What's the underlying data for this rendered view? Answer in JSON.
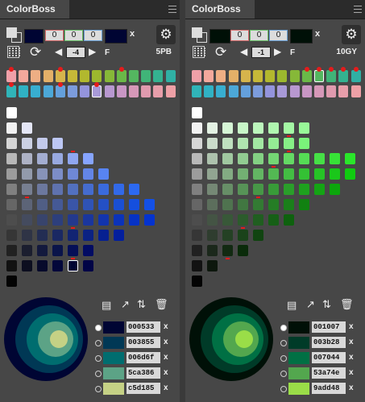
{
  "panels": [
    {
      "id": "left",
      "tab_title": "ColorBoss",
      "current_color": "#000533",
      "rgb": [
        "0",
        "0",
        "0"
      ],
      "rgb_outline": [
        "#d36a6a",
        "#6abf6a",
        "#6a9fd3"
      ],
      "clear_label": "x",
      "step_value": "-4",
      "f_label": "F",
      "hue_code": "5PB",
      "hue_row1": [
        "#f0a0a8",
        "#f4a89c",
        "#eeae84",
        "#e4b068",
        "#d6b44c",
        "#c6b838",
        "#b2b82e",
        "#9cb82e",
        "#86b838",
        "#6ab848",
        "#54b660",
        "#40b478",
        "#34b290",
        "#30b0a4"
      ],
      "hue_row2": [
        "#30b4b8",
        "#30b2c4",
        "#38aed0",
        "#4ca8d8",
        "#64a0dc",
        "#7c9cdc",
        "#9494dc",
        "#a89ad8",
        "#b898d0",
        "#c896c4",
        "#d698b8",
        "#e09aae",
        "#e89eaa",
        "#eea0a6"
      ],
      "hue_selected": 7,
      "hue_markers": [
        0,
        4,
        9
      ],
      "hue_row2_markers": [
        0,
        4,
        7
      ],
      "chart_rows": [
        [
          "#ffffff"
        ],
        [
          "#f2f2f2",
          "#e4e6f6"
        ],
        [
          "#d6d6d6",
          "#cbd0e3",
          "#c3caeb",
          "#bdc7f4"
        ],
        [
          "#b8b8b8",
          "#adb2c5",
          "#a3add1",
          "#98a9e0",
          "#8fa6f0",
          "#86a4ff"
        ],
        [
          "#9c9c9c",
          "#929aab",
          "#8793b8",
          "#7c8dc7",
          "#6f88d6",
          "#6385e6",
          "#5884f2"
        ],
        [
          "#808080",
          "#777f91",
          "#6c789e",
          "#5f72ae",
          "#5270bf",
          "#456ccf",
          "#3a6add",
          "#3269e8",
          "#2c69f2"
        ],
        [
          "#666666",
          "#5c6477",
          "#505e85",
          "#455996",
          "#3a55a7",
          "#2f53b6",
          "#2450c5",
          "#1a4fd3",
          "#154fde",
          "#1350e6"
        ],
        [
          "#4d4d4d",
          "#444b5e",
          "#38446c",
          "#2d3f7c",
          "#23398d",
          "#1a369d",
          "#1234ad",
          "#0b33ba",
          "#0632c5",
          "#0433cf"
        ],
        [
          "#363636",
          "#2f3446",
          "#232d53",
          "#1a2863",
          "#122473",
          "#0b2283",
          "#062091",
          "#031f9d"
        ],
        [
          "#212121",
          "#1b1e2f",
          "#13193d",
          "#0a144a",
          "#050f57",
          "#020c63"
        ],
        [
          "#121212",
          "#0c0e1f",
          "#070a2b",
          "#03073a",
          "#000533",
          "#000446"
        ],
        [
          "#030303"
        ]
      ],
      "chart_selected": [
        10,
        4
      ],
      "chart_markers": [
        [
          3,
          4
        ],
        [
          6,
          1
        ],
        [
          8,
          4
        ],
        [
          10,
          4
        ]
      ],
      "palette": [
        {
          "hex": "000533",
          "color": "#000533"
        },
        {
          "hex": "003855",
          "color": "#003855"
        },
        {
          "hex": "006d6f",
          "color": "#006d6f"
        },
        {
          "hex": "5ca386",
          "color": "#5ca386"
        },
        {
          "hex": "c5d185",
          "color": "#c5d185"
        }
      ],
      "palette_selected": 0,
      "remove_label": "x"
    },
    {
      "id": "right",
      "tab_title": "ColorBoss",
      "current_color": "#001007",
      "rgb": [
        "0",
        "0",
        "0"
      ],
      "rgb_outline": [
        "#d36a6a",
        "#6abf6a",
        "#6a9fd3"
      ],
      "clear_label": "x",
      "step_value": "-1",
      "f_label": "F",
      "hue_code": "10GY",
      "hue_row1": [
        "#f0a0a8",
        "#f4a89c",
        "#eeae84",
        "#e4b068",
        "#d6b44c",
        "#c6b838",
        "#b2b82e",
        "#9cb82e",
        "#86b838",
        "#6ab848",
        "#54b660",
        "#40b478",
        "#34b290",
        "#30b0a4"
      ],
      "hue_row2": [
        "#30b4b8",
        "#30b2c4",
        "#38aed0",
        "#4ca8d8",
        "#64a0dc",
        "#7c9cdc",
        "#9494dc",
        "#a89ad8",
        "#b898d0",
        "#c896c4",
        "#d698b8",
        "#e09aae",
        "#e89eaa",
        "#eea0a6"
      ],
      "hue_selected": 10,
      "hue_markers": [
        9,
        10,
        11,
        12,
        13
      ],
      "hue_row2_markers": [],
      "chart_rows": [
        [
          "#ffffff"
        ],
        [
          "#f2f2f2",
          "#e4f2e4",
          "#d6f6d6",
          "#c8f6c8",
          "#bcf7bc",
          "#b0f7b0",
          "#a4f8a4",
          "#98f898"
        ],
        [
          "#d6d6d6",
          "#cbdccb",
          "#bfe0bf",
          "#b0e4b0",
          "#a2e8a2",
          "#94ec94",
          "#86ef86",
          "#7af27a"
        ],
        [
          "#b8b8b8",
          "#adc2ad",
          "#a0c8a0",
          "#92cc92",
          "#83d183",
          "#74d574",
          "#64d964",
          "#55dd55",
          "#46e046",
          "#37e337",
          "#2ae62a"
        ],
        [
          "#9c9c9c",
          "#91a591",
          "#83ab83",
          "#73b073",
          "#63b563",
          "#53b953",
          "#43bd43",
          "#34c134",
          "#26c426",
          "#1ac71a",
          "#10ca10"
        ],
        [
          "#808080",
          "#758875",
          "#678e67",
          "#579357",
          "#479747",
          "#389b38",
          "#2a9e2a",
          "#1ea11e",
          "#14a414",
          "#0ca60c"
        ],
        [
          "#666666",
          "#5c6e5c",
          "#4f734f",
          "#417741",
          "#337a33",
          "#257d25",
          "#1a7f1a",
          "#118111"
        ],
        [
          "#4d4d4d",
          "#445444",
          "#385838",
          "#2c5b2c",
          "#205e20",
          "#165f16",
          "#0e610e"
        ],
        [
          "#363636",
          "#2f3d2f",
          "#244124",
          "#1a431a",
          "#114411"
        ],
        [
          "#212121",
          "#1b281b",
          "#122a12",
          "#0a2b0a"
        ],
        [
          "#121212",
          "#0d170d"
        ],
        [
          "#030303"
        ]
      ],
      "chart_selected": null,
      "chart_markers": [
        [
          4,
          5
        ],
        [
          6,
          4
        ],
        [
          8,
          3
        ],
        [
          10,
          2
        ],
        [
          2,
          6
        ],
        [
          3,
          6
        ]
      ],
      "palette": [
        {
          "hex": "001007",
          "color": "#001007"
        },
        {
          "hex": "003b28",
          "color": "#003b28"
        },
        {
          "hex": "007044",
          "color": "#007044"
        },
        {
          "hex": "53a74e",
          "color": "#53a74e"
        },
        {
          "hex": "9add48",
          "color": "#9add48"
        }
      ],
      "palette_selected": 0,
      "remove_label": "x"
    }
  ]
}
